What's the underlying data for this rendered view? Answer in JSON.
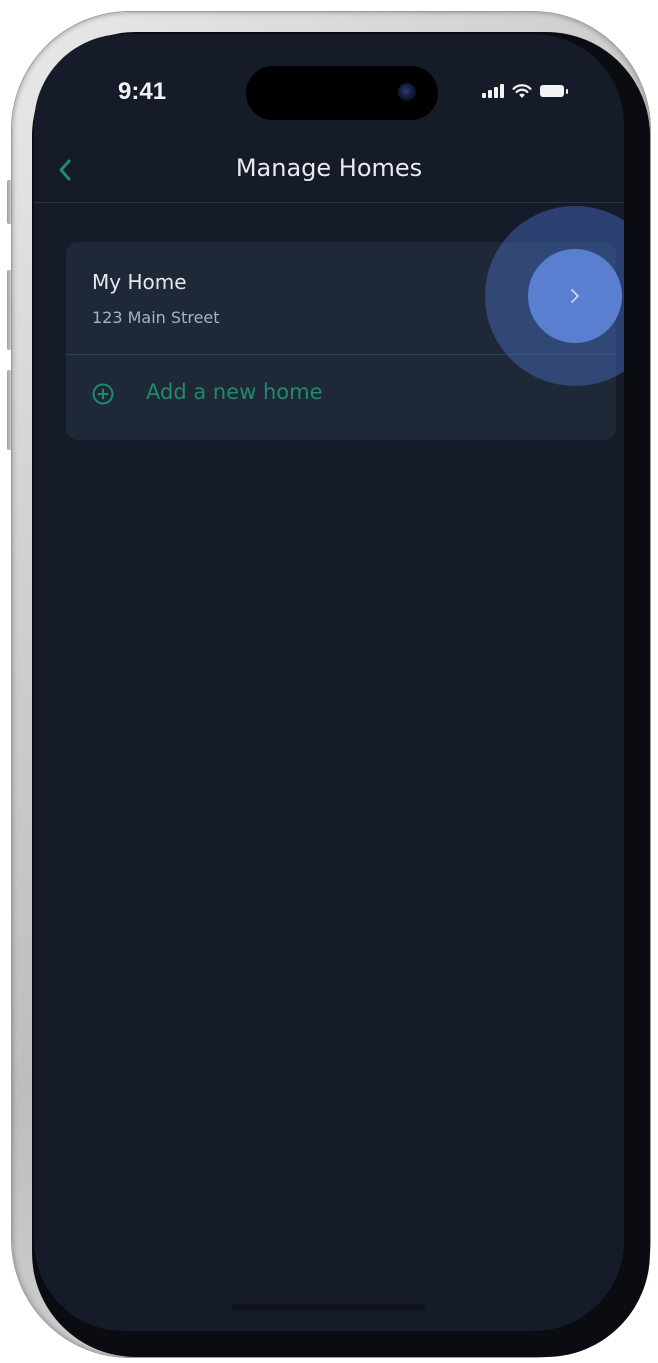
{
  "status_bar": {
    "time": "9:41",
    "icons": [
      "cellular-signal-icon",
      "wifi-icon",
      "battery-icon"
    ]
  },
  "nav": {
    "title": "Manage Homes",
    "back_icon": "chevron-left-icon"
  },
  "homes": [
    {
      "name": "My Home",
      "address": "123 Main Street",
      "chevron_icon": "chevron-right-icon"
    }
  ],
  "add_home": {
    "label": "Add a new home",
    "icon": "plus-circle-icon"
  },
  "colors": {
    "background": "#151b28",
    "card": "#1f2836",
    "accent": "#1e8a72",
    "tap_highlight": "#5b7fd0"
  }
}
